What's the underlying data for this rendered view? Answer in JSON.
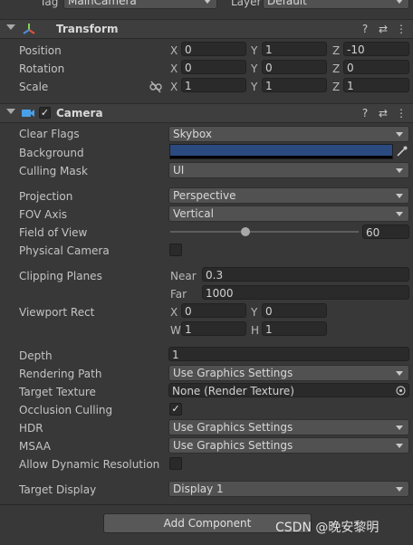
{
  "top": {
    "tag_label": "Tag",
    "tag_value": "MainCamera",
    "layer_label": "Layer",
    "layer_value": "Default"
  },
  "transform": {
    "title": "Transform",
    "position": {
      "label": "Position",
      "x": "0",
      "y": "1",
      "z": "-10"
    },
    "rotation": {
      "label": "Rotation",
      "x": "0",
      "y": "0",
      "z": "0"
    },
    "scale": {
      "label": "Scale",
      "x": "1",
      "y": "1",
      "z": "1"
    },
    "axis_x": "X",
    "axis_y": "Y",
    "axis_z": "Z"
  },
  "camera": {
    "title": "Camera",
    "enabled": true,
    "clear_flags": {
      "label": "Clear Flags",
      "value": "Skybox"
    },
    "background": {
      "label": "Background",
      "color": "#2b4a80"
    },
    "culling_mask": {
      "label": "Culling Mask",
      "value": "UI"
    },
    "projection": {
      "label": "Projection",
      "value": "Perspective"
    },
    "fov_axis": {
      "label": "FOV Axis",
      "value": "Vertical"
    },
    "field_of_view": {
      "label": "Field of View",
      "value": "60",
      "slider_fraction": 0.4
    },
    "physical_camera": {
      "label": "Physical Camera",
      "checked": false
    },
    "clipping_planes": {
      "label": "Clipping Planes",
      "near_label": "Near",
      "near": "0.3",
      "far_label": "Far",
      "far": "1000"
    },
    "viewport_rect": {
      "label": "Viewport Rect",
      "x_label": "X",
      "x": "0",
      "y_label": "Y",
      "y": "0",
      "w_label": "W",
      "w": "1",
      "h_label": "H",
      "h": "1"
    },
    "depth": {
      "label": "Depth",
      "value": "1"
    },
    "rendering_path": {
      "label": "Rendering Path",
      "value": "Use Graphics Settings"
    },
    "target_texture": {
      "label": "Target Texture",
      "value": "None (Render Texture)"
    },
    "occlusion_culling": {
      "label": "Occlusion Culling",
      "checked": true
    },
    "hdr": {
      "label": "HDR",
      "value": "Use Graphics Settings"
    },
    "msaa": {
      "label": "MSAA",
      "value": "Use Graphics Settings"
    },
    "dynamic_resolution": {
      "label": "Allow Dynamic Resolution",
      "checked": false
    },
    "target_display": {
      "label": "Target Display",
      "value": "Display 1"
    }
  },
  "add_component_label": "Add Component",
  "watermark": "CSDN @晚安黎明",
  "icons": {
    "help": "?",
    "settings": "⇄",
    "more": "⋮",
    "check": "✓"
  }
}
